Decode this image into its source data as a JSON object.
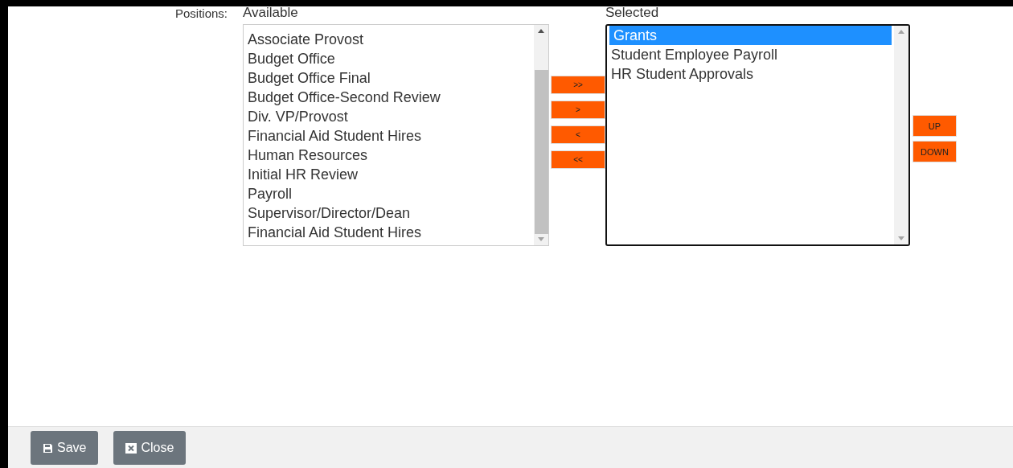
{
  "field_label": "Positions:",
  "available": {
    "heading": "Available",
    "items": [
      {
        "label": "Associate Provost",
        "selected": false
      },
      {
        "label": "Budget Office",
        "selected": false
      },
      {
        "label": "Budget Office Final",
        "selected": false
      },
      {
        "label": "Budget Office-Second Review",
        "selected": false
      },
      {
        "label": "Div. VP/Provost",
        "selected": false
      },
      {
        "label": "Financial Aid Student Hires",
        "selected": false
      },
      {
        "label": "Human Resources",
        "selected": false
      },
      {
        "label": "Initial HR Review",
        "selected": false
      },
      {
        "label": "Payroll",
        "selected": false
      },
      {
        "label": "Supervisor/Director/Dean",
        "selected": false
      },
      {
        "label": "Financial Aid Student Hires",
        "selected": false
      }
    ]
  },
  "transfer_buttons": [
    ">>",
    ">",
    "<",
    "<<"
  ],
  "selected": {
    "heading": "Selected",
    "items": [
      {
        "label": "Grants",
        "selected": true
      },
      {
        "label": "Student Employee Payroll",
        "selected": false
      },
      {
        "label": "HR Student Approvals",
        "selected": false
      }
    ]
  },
  "order_buttons": [
    "UP",
    "DOWN"
  ],
  "footer_buttons": [
    {
      "label": "Save",
      "kind": "save"
    },
    {
      "label": "Close",
      "kind": "close"
    }
  ]
}
